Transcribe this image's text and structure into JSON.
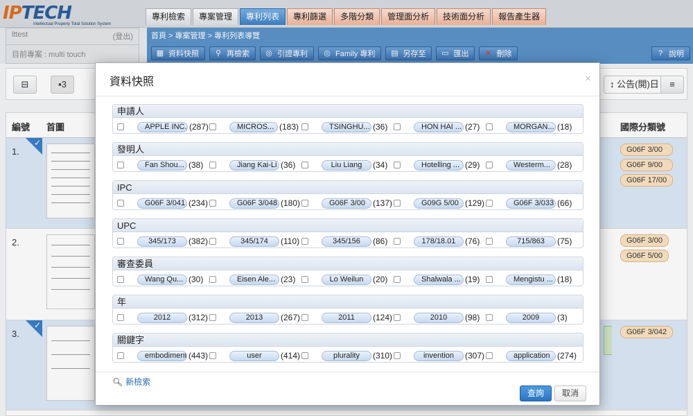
{
  "logo": {
    "brand_a": "IP",
    "brand_b": "TECH",
    "tagline": "Intellectual Property Total Solution System"
  },
  "tabs": [
    {
      "label": "專利檢索"
    },
    {
      "label": "專案管理"
    },
    {
      "label": "專利列表"
    },
    {
      "label": "專利篩選"
    },
    {
      "label": "多階分類"
    },
    {
      "label": "管理面分析"
    },
    {
      "label": "技術面分析"
    },
    {
      "label": "報告產生器"
    }
  ],
  "user": {
    "name": "lttest",
    "logout": "(登出)",
    "project": "目前專案 : multi touch"
  },
  "breadcrumb": "首頁 > 專案管理 > 專利列表導覽",
  "toolbar": {
    "snapshot": "資料快照",
    "research": "再檢索",
    "cited": "引證專利",
    "family": "Family 專利",
    "saveas": "另存至",
    "export": "匯出",
    "delete": "刪除",
    "help": "說明"
  },
  "list": {
    "page_count": "3",
    "sort_label": "公告(開)日",
    "headers": {
      "num": "編號",
      "image": "首圖",
      "ipc": "國際分類號"
    },
    "rows": [
      {
        "num": "1.",
        "selected": true,
        "ipcs": [
          "G06F 3/00",
          "G06F 9/00",
          "G06F 17/00"
        ]
      },
      {
        "num": "2.",
        "selected": false,
        "ipcs": [
          "G06F 3/00",
          "G06F 5/00"
        ]
      },
      {
        "num": "3.",
        "selected": true,
        "ipcs": [
          "G06F 3/042"
        ]
      }
    ]
  },
  "modal": {
    "title": "資料快照",
    "close": "×",
    "facets": [
      {
        "title": "申請人",
        "items": [
          {
            "label": "APPLE INC.",
            "count": "(287)"
          },
          {
            "label": "MICROS...",
            "count": "(183)"
          },
          {
            "label": "TSINGHU...",
            "count": "(36)"
          },
          {
            "label": "HON HAI ...",
            "count": "(27)"
          },
          {
            "label": "MORGAN...",
            "count": "(18)"
          }
        ]
      },
      {
        "title": "發明人",
        "items": [
          {
            "label": "Fan Shou...",
            "count": "(38)"
          },
          {
            "label": "Jiang Kai-Li",
            "count": "(36)"
          },
          {
            "label": "Liu Liang",
            "count": "(34)"
          },
          {
            "label": "Hotelling ...",
            "count": "(29)"
          },
          {
            "label": "Westerm...",
            "count": "(28)"
          }
        ]
      },
      {
        "title": "IPC",
        "items": [
          {
            "label": "G06F 3/041",
            "count": "(234)"
          },
          {
            "label": "G06F 3/048",
            "count": "(180)"
          },
          {
            "label": "G06F 3/00",
            "count": "(137)"
          },
          {
            "label": "G09G 5/00",
            "count": "(129)"
          },
          {
            "label": "G06F 3/033",
            "count": "(66)"
          }
        ]
      },
      {
        "title": "UPC",
        "items": [
          {
            "label": "345/173",
            "count": "(382)"
          },
          {
            "label": "345/174",
            "count": "(110)"
          },
          {
            "label": "345/156",
            "count": "(86)"
          },
          {
            "label": "178/18.01",
            "count": "(76)"
          },
          {
            "label": "715/863",
            "count": "(75)"
          }
        ]
      },
      {
        "title": "審查委員",
        "items": [
          {
            "label": "Wang Qu...",
            "count": "(30)"
          },
          {
            "label": "Eisen Ale...",
            "count": "(23)"
          },
          {
            "label": "Lo Weilun",
            "count": "(20)"
          },
          {
            "label": "Shalwala ...",
            "count": "(19)"
          },
          {
            "label": "Mengistu ...",
            "count": "(18)"
          }
        ]
      },
      {
        "title": "年",
        "items": [
          {
            "label": "2012",
            "count": "(312)"
          },
          {
            "label": "2013",
            "count": "(267)"
          },
          {
            "label": "2011",
            "count": "(124)"
          },
          {
            "label": "2010",
            "count": "(98)"
          },
          {
            "label": "2009",
            "count": "(3)"
          }
        ]
      },
      {
        "title": "關鍵字",
        "items": [
          {
            "label": "embodiment",
            "count": "(443)"
          },
          {
            "label": "user",
            "count": "(414)"
          },
          {
            "label": "plurality",
            "count": "(310)"
          },
          {
            "label": "invention",
            "count": "(307)"
          },
          {
            "label": "application",
            "count": "(274)"
          }
        ]
      }
    ],
    "new_search": "新檢索",
    "query_button": "查詢",
    "cancel_button": "取消"
  },
  "colors": {
    "accent": "#3b82c8",
    "toolbar": "#5b93c9",
    "pill": "#c7d9ef",
    "ipc_badge": "#fbe3c4"
  }
}
